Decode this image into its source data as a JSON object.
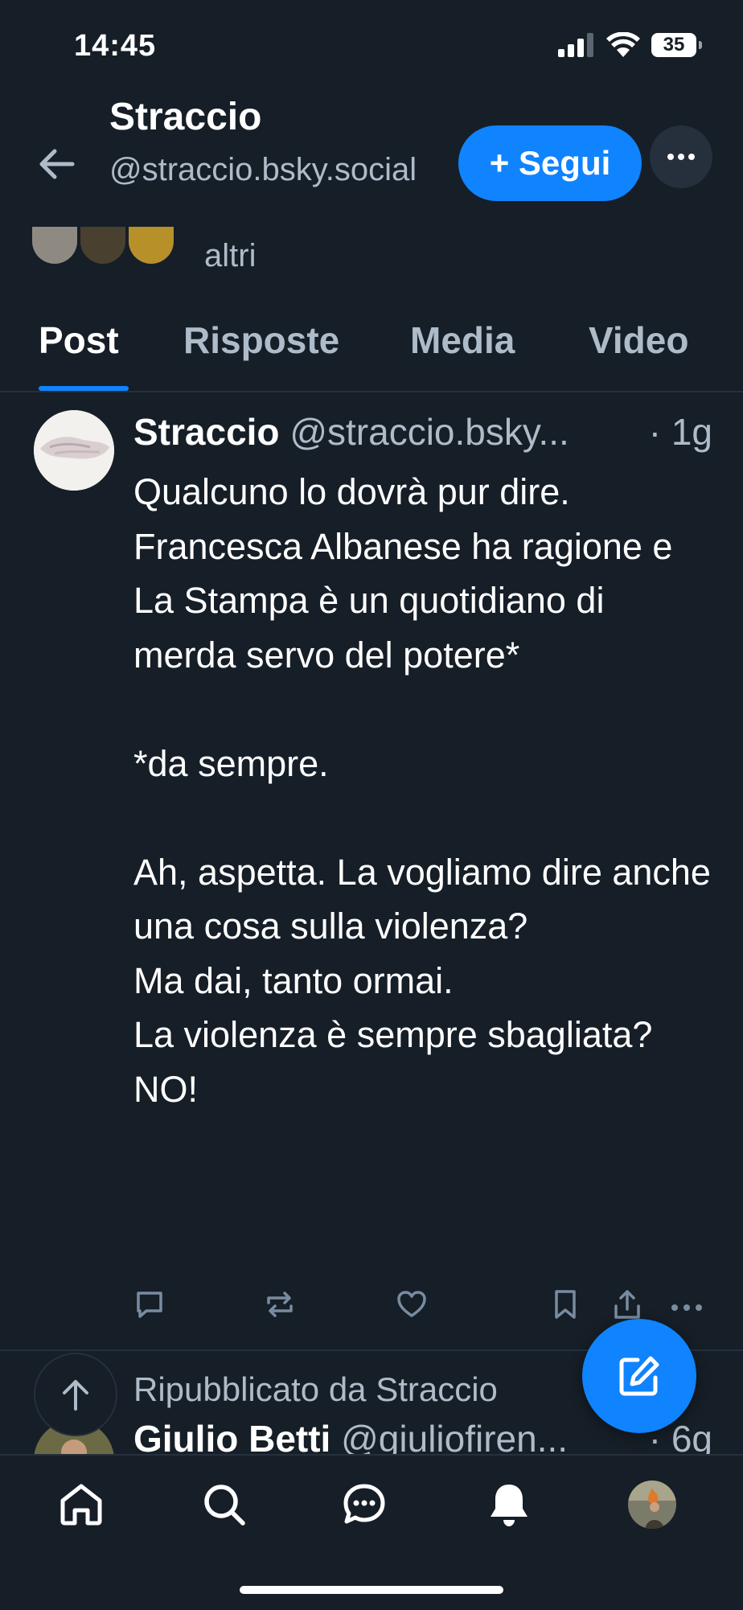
{
  "status_bar": {
    "time": "14:45",
    "battery": "35"
  },
  "profile": {
    "name": "Straccio",
    "handle": "@straccio.bsky.social",
    "follow_label": "+ Segui",
    "followers_snippet": "altri"
  },
  "tabs": [
    {
      "label": "Post",
      "active": true
    },
    {
      "label": "Risposte",
      "active": false
    },
    {
      "label": "Media",
      "active": false
    },
    {
      "label": "Video",
      "active": false
    }
  ],
  "post": {
    "author": "Straccio",
    "handle": "@straccio.bsky...",
    "separator": "·",
    "time": "1g",
    "text": "Qualcuno lo dovrà pur dire.\nFrancesca Albanese ha ragione e La Stampa è un quotidiano di merda servo del potere*\n\n*da sempre.\n\nAh, aspetta. La vogliamo dire anche una cosa sulla violenza?\nMa dai, tanto ormai.\nLa violenza è sempre sbagliata?\nNO!",
    "actions": [
      "reply-icon",
      "repost-icon",
      "like-icon",
      "bookmark-icon",
      "share-icon",
      "more-icon"
    ]
  },
  "next_post": {
    "repost_label": "Ripubblicato da Straccio",
    "author": "Giulio Betti",
    "handle": "@giuliofiren...",
    "time": "· 6g"
  },
  "bottom_nav": [
    "home-icon",
    "search-icon",
    "chat-icon",
    "notifications-icon",
    "profile-avatar"
  ],
  "colors": {
    "background": "#161e27",
    "accent": "#1083fe",
    "muted": "#aebbc9",
    "divider": "#26303c"
  }
}
